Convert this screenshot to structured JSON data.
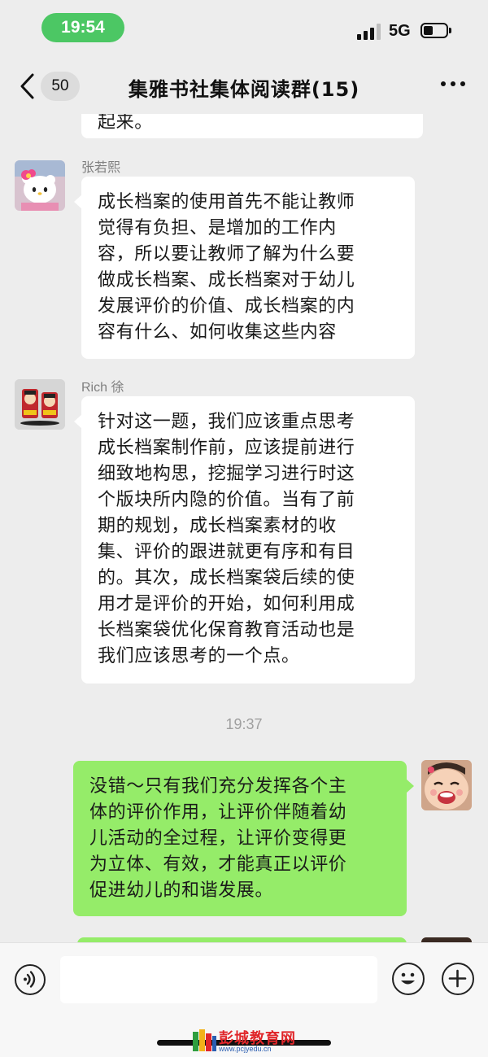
{
  "status_bar": {
    "time": "19:54",
    "network": "5G"
  },
  "nav": {
    "unread_count": "50",
    "title": "集雅书社集体阅读群(15)"
  },
  "messages": [
    {
      "id": "partial",
      "side": "left",
      "visible_tail": "起来。"
    },
    {
      "id": "m1",
      "side": "left",
      "sender": "张若熙",
      "lines": [
        "成长档案的使用首先不能让教师",
        "觉得有负担、是增加的工作内",
        "容，所以要让教师了解为什么要",
        "做成长档案、成长档案对于幼儿",
        "发展评价的价值、成长档案的内",
        "容有什么、如何收集这些内容"
      ]
    },
    {
      "id": "m2",
      "side": "left",
      "sender": "Rich 徐",
      "lines": [
        "针对这一题，我们应该重点思考",
        "成长档案制作前，应该提前进行",
        "细致地构思，挖掘学习进行时这",
        "个版块所内隐的价值。当有了前",
        "期的规划，成长档案素材的收",
        "集、评价的跟进就更有序和有目",
        "的。其次，成长档案袋后续的使",
        "用才是评价的开始，如何利用成",
        "长档案袋优化保育教育活动也是",
        "我们应该思考的一个点。"
      ]
    },
    {
      "id": "m3",
      "side": "right",
      "lines": [
        "没错～只有我们充分发挥各个主",
        "体的评价作用，让评价伴随着幼",
        "儿活动的全过程，让评价变得更",
        "为立体、有效，才能真正以评价",
        "促进幼儿的和谐发展。"
      ]
    }
  ],
  "timestamp": "19:37",
  "watermark": {
    "title": "彭城教育网",
    "url": "www.pcjyedu.cn"
  },
  "icons": {
    "back": "chevron-left-icon",
    "more": "more-dots-icon",
    "voice": "voice-icon",
    "emoji": "emoji-icon",
    "plus": "plus-icon"
  },
  "colors": {
    "time_pill": "#4cc764",
    "sent_bubble": "#95ec69",
    "received_bubble": "#ffffff",
    "chat_background": "#ededed"
  }
}
